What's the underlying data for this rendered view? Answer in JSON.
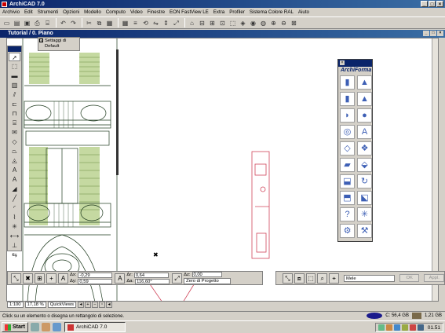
{
  "window": {
    "title": "ArchiCAD 7.0"
  },
  "menu": [
    "Archivio",
    "Edit",
    "Strumenti",
    "Opzioni",
    "Modello",
    "Computo",
    "Video",
    "Finestre",
    "EON FastView LE",
    "Extra",
    "Profiler",
    "Sistema Colore RAL",
    "Aiuto"
  ],
  "document": {
    "title": "Tutorial / 0. Piano"
  },
  "settings_tab": {
    "label": "Settaggi di Default"
  },
  "archiforma": {
    "title": "ArchiForma"
  },
  "infobox": {
    "dx_label": "Δx:",
    "dx_value": "-0,29",
    "dy_label": "Δy:",
    "dy_value": "0,59",
    "dr_label": "Δr:",
    "dr_value": "0,64",
    "da_label": "Δa:",
    "da_value": "116,60°",
    "dz_label": "Δz:",
    "dz_value": "0,00",
    "project_select": "Zero di Progetto",
    "mode_select": "Mele",
    "ok_label": "OK",
    "apply_label": "Appl."
  },
  "bottombar": {
    "scale": "1:100",
    "zoom": "17,18 %",
    "view": "QuickViews"
  },
  "status": {
    "message": "Click su un elemento o disegna un rettangolo di selezione.",
    "disk1": "C: 56,4 GB",
    "disk2": "1,21 GB"
  },
  "taskbar": {
    "start": "Start",
    "task": "ArchiCAD 7.0",
    "clock": "01.51"
  }
}
